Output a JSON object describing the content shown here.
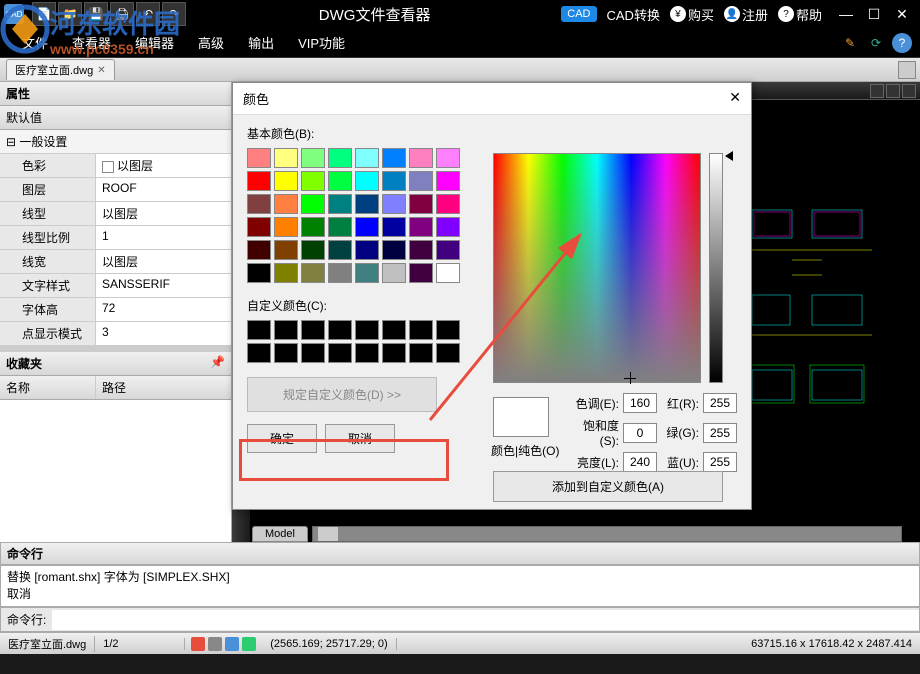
{
  "titlebar": {
    "app_title": "DWG文件查看器",
    "cad_convert": "CAD转换",
    "buy": "购买",
    "register": "注册",
    "help": "帮助"
  },
  "menus": [
    "文件",
    "查看器",
    "编辑器",
    "高级",
    "输出",
    "VIP功能"
  ],
  "document_tab": "医疗室立面.dwg",
  "properties": {
    "title": "属性",
    "default_value": "默认值",
    "general_settings": "一般设置",
    "rows": [
      {
        "k": "色彩",
        "v": "以图层",
        "cb": true
      },
      {
        "k": "图层",
        "v": "ROOF"
      },
      {
        "k": "线型",
        "v": "以图层"
      },
      {
        "k": "线型比例",
        "v": "1"
      },
      {
        "k": "线宽",
        "v": "以图层"
      },
      {
        "k": "文字样式",
        "v": "SANSSERIF"
      },
      {
        "k": "字体高",
        "v": "72"
      },
      {
        "k": "点显示模式",
        "v": "3"
      }
    ]
  },
  "favorites": {
    "title": "收藏夹",
    "col1": "名称",
    "col2": "路径"
  },
  "model_tab": "Model",
  "command": {
    "title": "命令行",
    "history1": "替换 [romant.shx] 字体为 [SIMPLEX.SHX]",
    "history2": "取消",
    "prompt": "命令行:"
  },
  "statusbar": {
    "file": "医疗室立面.dwg",
    "pages": "1/2",
    "coords": "(2565.169; 25717.29; 0)",
    "extents": "63715.16 x 17618.42 x 2487.414"
  },
  "color_dialog": {
    "title": "颜色",
    "basic_label": "基本颜色(B):",
    "custom_label": "自定义颜色(C):",
    "define_custom": "规定自定义颜色(D) >>",
    "ok": "确定",
    "cancel": "取消",
    "pure_color": "颜色|纯色(O)",
    "hue": "色调(E):",
    "sat": "饱和度(S):",
    "lum": "亮度(L):",
    "red": "红(R):",
    "green": "绿(G):",
    "blue": "蓝(U):",
    "hue_v": "160",
    "sat_v": "0",
    "lum_v": "240",
    "red_v": "255",
    "green_v": "255",
    "blue_v": "255",
    "add_custom": "添加到自定义颜色(A)",
    "basic_colors": [
      "#ff8080",
      "#ffff80",
      "#80ff80",
      "#00ff80",
      "#80ffff",
      "#0080ff",
      "#ff80c0",
      "#ff80ff",
      "#ff0000",
      "#ffff00",
      "#80ff00",
      "#00ff40",
      "#00ffff",
      "#0080c0",
      "#8080c0",
      "#ff00ff",
      "#804040",
      "#ff8040",
      "#00ff00",
      "#008080",
      "#004080",
      "#8080ff",
      "#800040",
      "#ff0080",
      "#800000",
      "#ff8000",
      "#008000",
      "#008040",
      "#0000ff",
      "#0000a0",
      "#800080",
      "#8000ff",
      "#400000",
      "#804000",
      "#004000",
      "#004040",
      "#000080",
      "#000040",
      "#400040",
      "#400080",
      "#000000",
      "#808000",
      "#808040",
      "#808080",
      "#408080",
      "#c0c0c0",
      "#400040",
      "#ffffff"
    ]
  },
  "watermark": {
    "line1": "河东软件园",
    "line2": "www.pc0359.cn"
  }
}
